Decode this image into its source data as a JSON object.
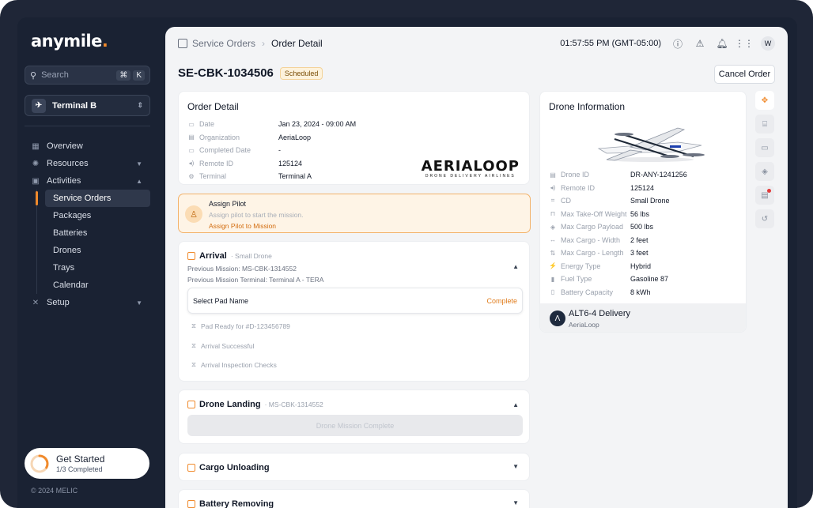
{
  "brand": {
    "logo_main": "anymile",
    "logo_dot": "."
  },
  "sidebar": {
    "search_placeholder": "Search",
    "search_kbd_1": "⌘",
    "search_kbd_2": "K",
    "terminal": "Terminal B",
    "nav": [
      {
        "label": "Overview"
      },
      {
        "label": "Resources"
      },
      {
        "label": "Activities"
      }
    ],
    "activities_sub": [
      {
        "label": "Service Orders"
      },
      {
        "label": "Packages"
      },
      {
        "label": "Batteries"
      },
      {
        "label": "Drones"
      },
      {
        "label": "Trays"
      },
      {
        "label": "Calendar"
      }
    ],
    "setup": "Setup",
    "get_started": {
      "title": "Get Started",
      "sub": "1/3 Completed",
      "progress": 0.33
    },
    "copyright": "© 2024 MELIC"
  },
  "topbar": {
    "crumb_parent": "Service Orders",
    "crumb_current": "Order Detail",
    "time": "01:57:55 PM (GMT-05:00)",
    "avatar": "W"
  },
  "order": {
    "id": "SE-CBK-1034506",
    "status": "Scheduled",
    "cancel_label": "Cancel Order"
  },
  "order_detail": {
    "title": "Order Detail",
    "rows": [
      {
        "k": "Date",
        "v": "Jan 23, 2024 - 09:00 AM"
      },
      {
        "k": "Organization",
        "v": "AeriaLoop"
      },
      {
        "k": "Completed Date",
        "v": "-"
      },
      {
        "k": "Remote ID",
        "v": "125124"
      },
      {
        "k": "Terminal",
        "v": "Terminal A"
      }
    ],
    "brand_name": "AERIALOOP",
    "brand_tag": "DRONE DELIVERY AIRLINES"
  },
  "assign": {
    "title": "Assign Pilot",
    "desc": "Assign pilot to start the mission.",
    "link": "Assign Pilot to Mission"
  },
  "arrival": {
    "title": "Arrival",
    "sub": "· Small Drone",
    "prev_mission": "Previous Mission:  MS-CBK-1314552",
    "prev_terminal": "Previous Mission Terminal:  Terminal A - TERA",
    "pad_label": "Select Pad Name",
    "pad_status": "Complete",
    "steps": [
      {
        "label": "Pad Ready for #D-123456789"
      },
      {
        "label": "Arrival Successful"
      },
      {
        "label": "Arrival Inspection Checks"
      }
    ]
  },
  "landing": {
    "title": "Drone Landing",
    "sub": "· MS-CBK-1314552",
    "button": "Drone Mission Complete"
  },
  "cargo": {
    "title": "Cargo Unloading"
  },
  "battery": {
    "title": "Battery Removing"
  },
  "drone": {
    "title": "Drone Information",
    "rows": [
      {
        "k": "Drone ID",
        "v": "DR-ANY-1241256"
      },
      {
        "k": "Remote ID",
        "v": "125124"
      },
      {
        "k": "CD",
        "v": "Small Drone"
      },
      {
        "k": "Max Take-Off Weight",
        "v": "56 lbs"
      },
      {
        "k": "Max Cargo Payload",
        "v": "500 lbs"
      },
      {
        "k": "Max Cargo - Width",
        "v": "2 feet"
      },
      {
        "k": "Max Cargo - Length",
        "v": "3 feet"
      },
      {
        "k": "Energy Type",
        "v": "Hybrid"
      },
      {
        "k": "Fuel Type",
        "v": "Gasoline 87"
      },
      {
        "k": "Battery Capacity",
        "v": "8 kWh"
      }
    ],
    "model": "ALT6-4 Delivery",
    "operator": "AeriaLoop"
  },
  "colors": {
    "accent": "#f08a2c",
    "sidebar": "#1a2233",
    "alert": "#e23b3b"
  }
}
